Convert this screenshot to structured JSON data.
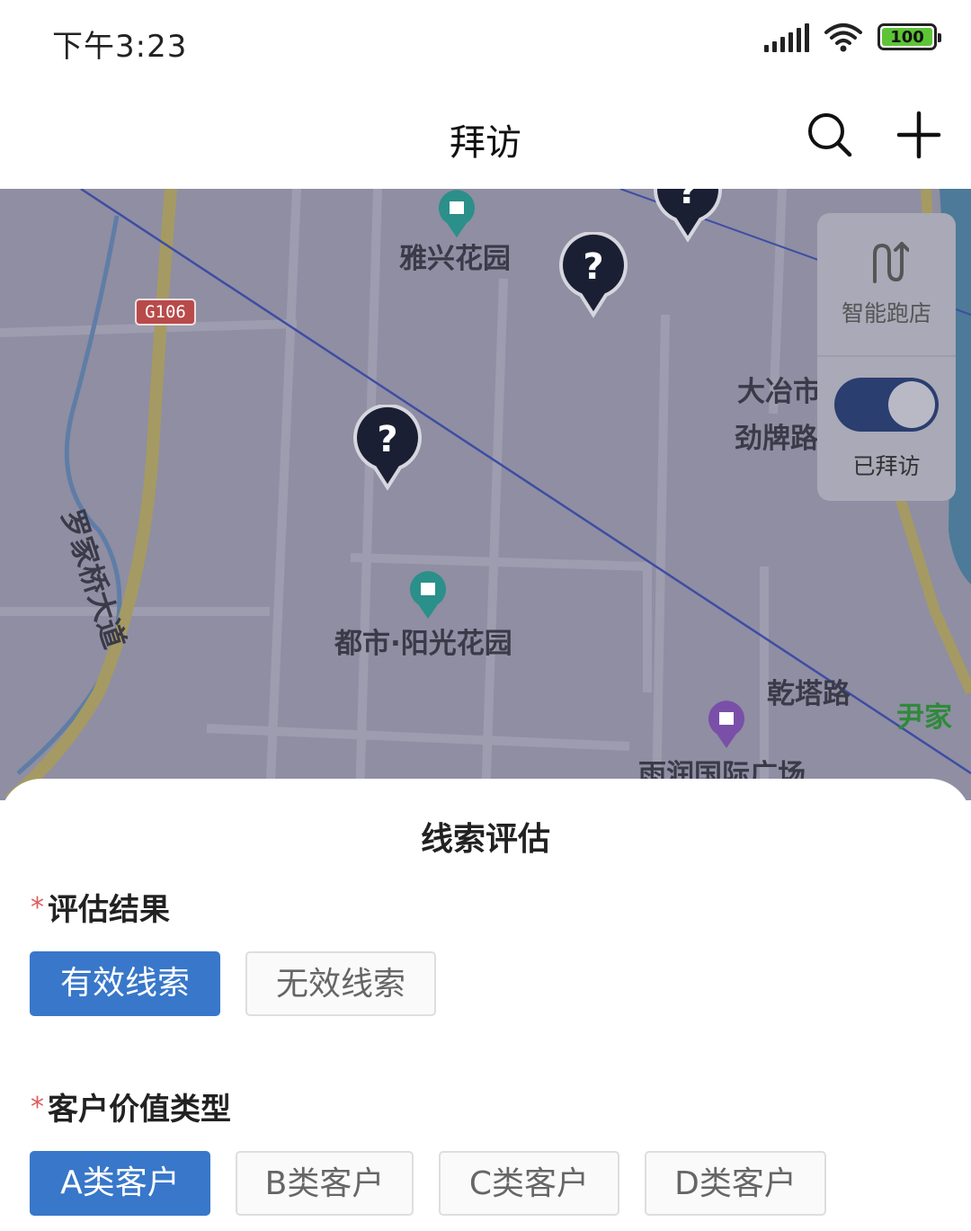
{
  "status_bar": {
    "time": "下午3:23",
    "battery": "100",
    "icons": [
      "signal-icon",
      "wifi-icon",
      "battery-icon"
    ]
  },
  "nav": {
    "title": "拜访",
    "icons": [
      "search-icon",
      "add-icon"
    ]
  },
  "map": {
    "road_shield": "G106",
    "labels": {
      "yaxing": "雅兴花园",
      "dayeshi": "大冶市",
      "jinpai": "劲牌路",
      "luojiaqiao": "罗家桥大道",
      "dushi": "都市·阳光花园",
      "qianta": "乾塔路",
      "yinjia": "尹家",
      "yurun": "雨润国际广场"
    },
    "pin_icon": "question-pin-icon",
    "smart_panel": {
      "smart_label": "智能跑店",
      "visited_label": "已拜访",
      "visited_toggle_on": true
    }
  },
  "sheet": {
    "title": "线索评估",
    "required_mark": "*",
    "eval_result": {
      "label": "评估结果",
      "options": [
        "有效线索",
        "无效线索"
      ],
      "selected": "有效线索"
    },
    "customer_type": {
      "label": "客户价值类型",
      "options": [
        "A类客户",
        "B类客户",
        "C类客户",
        "D类客户"
      ],
      "selected": "A类客户"
    }
  },
  "colors": {
    "primary": "#3877c9",
    "map_overlay": "#8f8ea3",
    "toggle_on": "#2a3e6f",
    "required": "#e05a5a"
  }
}
